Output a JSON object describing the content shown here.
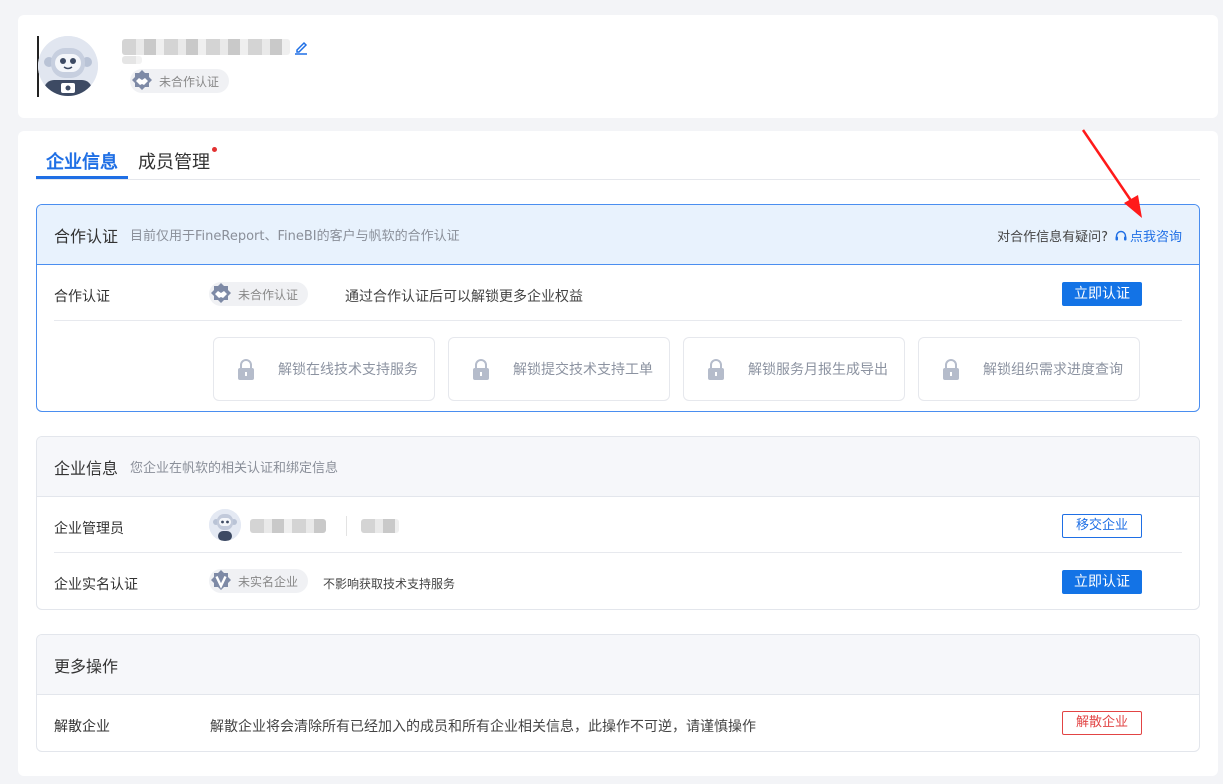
{
  "profile": {
    "username": "",
    "badge_text": "未合作认证"
  },
  "tabs": [
    {
      "label": "企业信息",
      "active": true
    },
    {
      "label": "成员管理",
      "active": false,
      "has_dot": true
    }
  ],
  "cooperation": {
    "title": "合作认证",
    "subtitle": "目前仅用于FineReport、FineBI的客户与帆软的合作认证",
    "question": "对合作信息有疑问?",
    "consult_link": "点我咨询",
    "row_label": "合作认证",
    "badge_text": "未合作认证",
    "description": "通过合作认证后可以解锁更多企业权益",
    "action_button": "立即认证",
    "features": [
      {
        "label": "解锁在线技术支持服务",
        "icon": "lock-icon"
      },
      {
        "label": "解锁提交技术支持工单",
        "icon": "lock-icon"
      },
      {
        "label": "解锁服务月报生成导出",
        "icon": "lock-icon"
      },
      {
        "label": "解锁组织需求进度查询",
        "icon": "lock-icon"
      }
    ]
  },
  "enterprise": {
    "title": "企业信息",
    "subtitle": "您企业在帆软的相关认证和绑定信息",
    "admin_label": "企业管理员",
    "transfer_button": "移交企业",
    "realname_label": "企业实名认证",
    "realname_badge": "未实名企业",
    "realname_desc": "不影响获取技术支持服务",
    "realname_button": "立即认证"
  },
  "more": {
    "title": "更多操作",
    "dissolve_label": "解散企业",
    "dissolve_desc": "解散企业将会清除所有已经加入的成员和所有企业相关信息，此操作不可逆，请谨慎操作",
    "dissolve_button": "解散企业"
  },
  "colors": {
    "primary": "#1373e6",
    "danger": "#e24444",
    "annotation": "#ff1a1a"
  }
}
